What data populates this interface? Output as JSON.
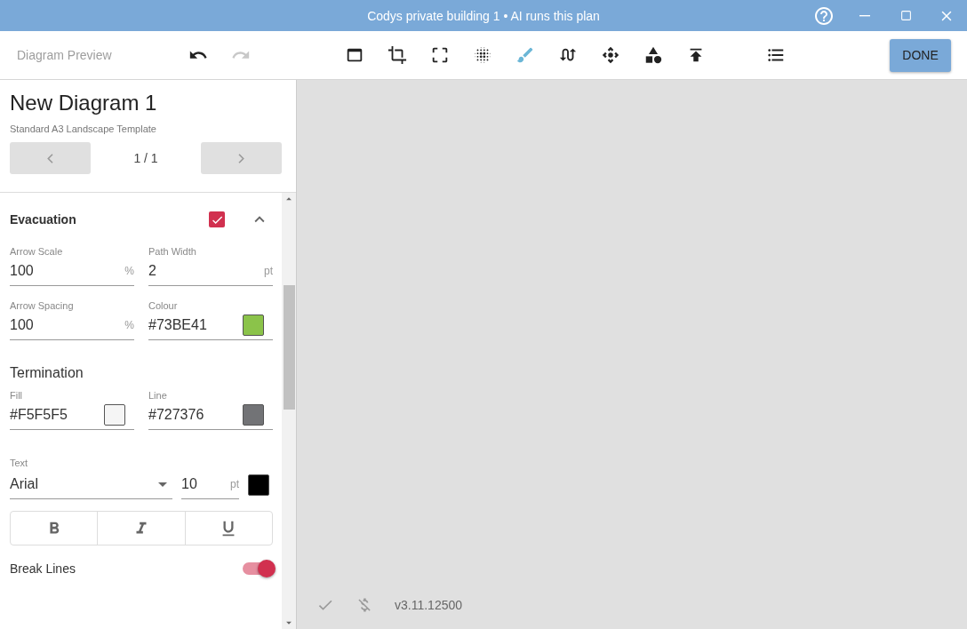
{
  "window": {
    "title": "Codys private building 1 • AI runs this plan"
  },
  "toolbar": {
    "title": "Diagram Preview",
    "undo_disabled": false,
    "redo_disabled": true,
    "tools": [
      {
        "kind": "layout",
        "selected": false
      },
      {
        "kind": "crop",
        "selected": false
      },
      {
        "kind": "frame",
        "selected": false
      },
      {
        "kind": "scatter",
        "selected": false
      },
      {
        "kind": "brush",
        "selected": true
      },
      {
        "kind": "route",
        "selected": false
      },
      {
        "kind": "move",
        "selected": false
      },
      {
        "kind": "shapes",
        "selected": false
      },
      {
        "kind": "top",
        "selected": false
      },
      {
        "kind": "list",
        "selected": false
      }
    ],
    "done": "DONE"
  },
  "sidebar": {
    "diagram_title": "New Diagram 1",
    "template": "Standard A3 Landscape Template",
    "page": "1 / 1",
    "section": {
      "title": "Evacuation",
      "checked": true,
      "expanded": true
    },
    "fields": [
      {
        "label": "Arrow Scale",
        "value": "100",
        "unit": "%"
      },
      {
        "label": "Path Width",
        "value": "2",
        "unit": "pt"
      },
      {
        "label": "Arrow Spacing",
        "value": "100",
        "unit": "%"
      },
      {
        "label": "Colour",
        "value": "#73BE41",
        "color": "#8bc34a"
      }
    ],
    "termination": {
      "heading": "Termination",
      "fields": [
        {
          "label": "Fill",
          "value": "#F5F5F5",
          "color": "#f5f5f5"
        },
        {
          "label": "Line",
          "value": "#727376",
          "color": "#727376"
        }
      ]
    },
    "text": {
      "label": "Text",
      "font": "Arial",
      "size": "10",
      "unit": "pt",
      "color": "#000000"
    },
    "format_buttons": [
      {
        "kind": "bold",
        "selected": false
      },
      {
        "kind": "italic",
        "selected": false
      },
      {
        "kind": "underline",
        "selected": false
      }
    ],
    "break_lines": {
      "label": "Break Lines",
      "on": true
    }
  },
  "status": {
    "version": "v3.11.12500"
  }
}
